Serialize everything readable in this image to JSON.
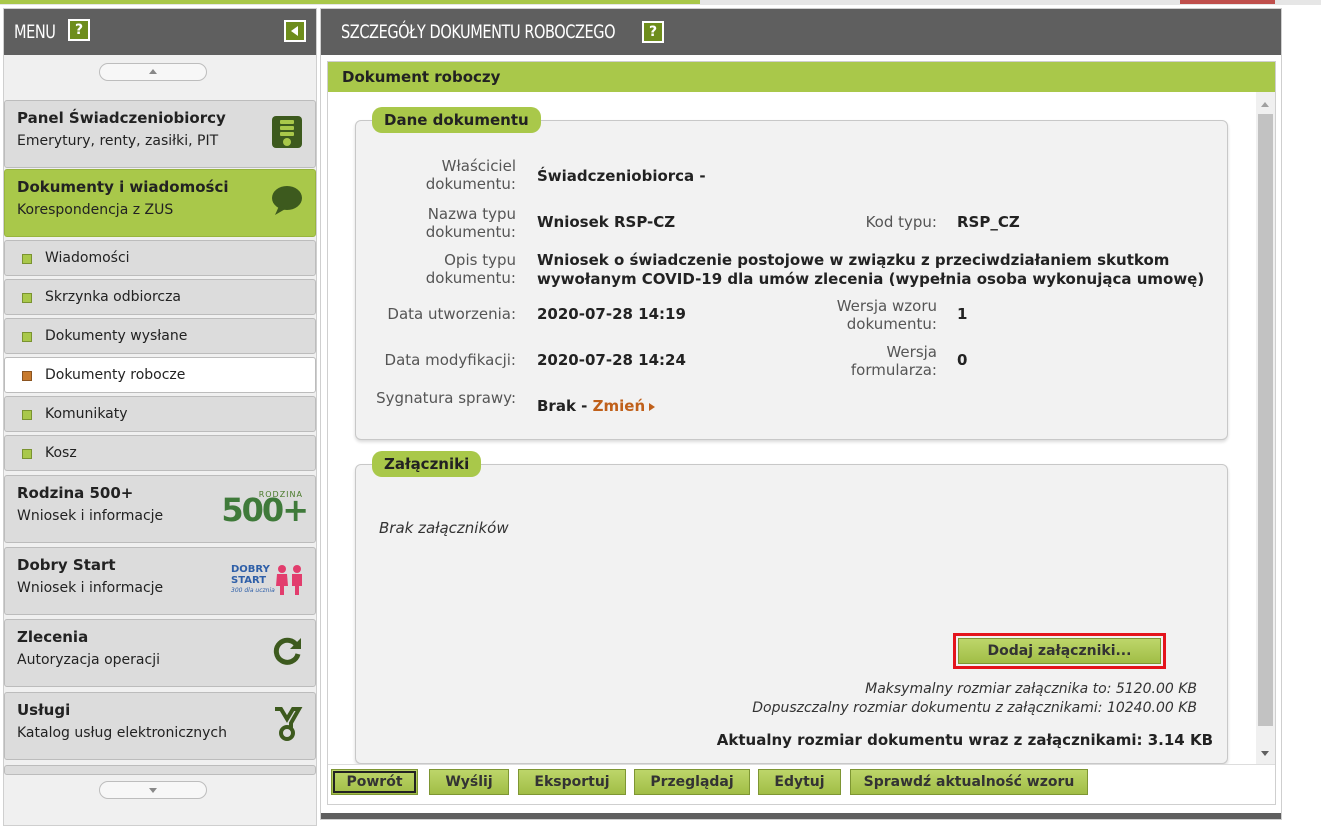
{
  "menu": {
    "title": "MENU",
    "help": "?",
    "sections": {
      "panel": {
        "title": "Panel Świadczeniobiorcy",
        "subtitle": "Emerytury, renty, zasiłki, PIT"
      },
      "dokumenty": {
        "title": "Dokumenty i wiadomości",
        "subtitle": "Korespondencja z ZUS"
      },
      "rodzina": {
        "title": "Rodzina 500+",
        "subtitle": "Wniosek i informacje",
        "logo_small": "RODZINA",
        "logo_big": "500+"
      },
      "dobry": {
        "title": "Dobry Start",
        "subtitle": "Wniosek i informacje",
        "logo_line1": "DOBRY",
        "logo_line2": "START",
        "logo_line3": "300 dla ucznia"
      },
      "zlecenia": {
        "title": "Zlecenia",
        "subtitle": "Autoryzacja operacji"
      },
      "uslugi": {
        "title": "Usługi",
        "subtitle": "Katalog usług elektronicznych"
      }
    },
    "subitems": [
      "Wiadomości",
      "Skrzynka odbiorcza",
      "Dokumenty wysłane",
      "Dokumenty robocze",
      "Komunikaty",
      "Kosz"
    ]
  },
  "main": {
    "title": "SZCZEGÓŁY DOKUMENTU ROBOCZEGO",
    "help": "?",
    "panel_title": "Dokument roboczy",
    "details": {
      "legend": "Dane dokumentu",
      "owner_label": "Właściciel dokumentu:",
      "owner_value": "Świadczeniobiorca -",
      "type_name_label": "Nazwa typu dokumentu:",
      "type_name_value": "Wniosek RSP-CZ",
      "type_code_label": "Kod typu:",
      "type_code_value": "RSP_CZ",
      "type_desc_label": "Opis typu dokumentu:",
      "type_desc_value_1": "Wniosek o świadczenie postojowe w związku z przeciwdziałaniem skutkom",
      "type_desc_value_2": "wywołanym COVID-19 dla umów zlecenia (wypełnia osoba wykonująca umowę)",
      "created_label": "Data utworzenia:",
      "created_value": "2020-07-28 14:19",
      "template_version_label": "Wersja wzoru dokumentu:",
      "template_version_value": "1",
      "modified_label": "Data modyfikacji:",
      "modified_value": "2020-07-28 14:24",
      "form_version_label": "Wersja formularza:",
      "form_version_value": "0",
      "signature_label": "Sygnatura sprawy:",
      "signature_value": "Brak -",
      "change_link": "Zmień"
    },
    "attachments": {
      "legend": "Załączniki",
      "empty": "Brak załączników",
      "add_button": "Dodaj załączniki...",
      "max_size": "Maksymalny rozmiar załącznika to: 5120.00 KB",
      "allowed_size": "Dopuszczalny rozmiar dokumentu z załącznikami: 10240.00 KB",
      "current_size": "Aktualny rozmiar dokumentu wraz z załącznikami: 3.14 KB"
    },
    "buttons": {
      "back": "Powrót",
      "send": "Wyślij",
      "export": "Eksportuj",
      "preview": "Przeglądaj",
      "edit": "Edytuj",
      "check": "Sprawdź aktualność wzoru"
    }
  },
  "colors": {
    "accent_green": "#a9c84a",
    "header_gray": "#5f5f5f",
    "link_orange": "#c0601a",
    "highlight_red": "#e4141c"
  }
}
